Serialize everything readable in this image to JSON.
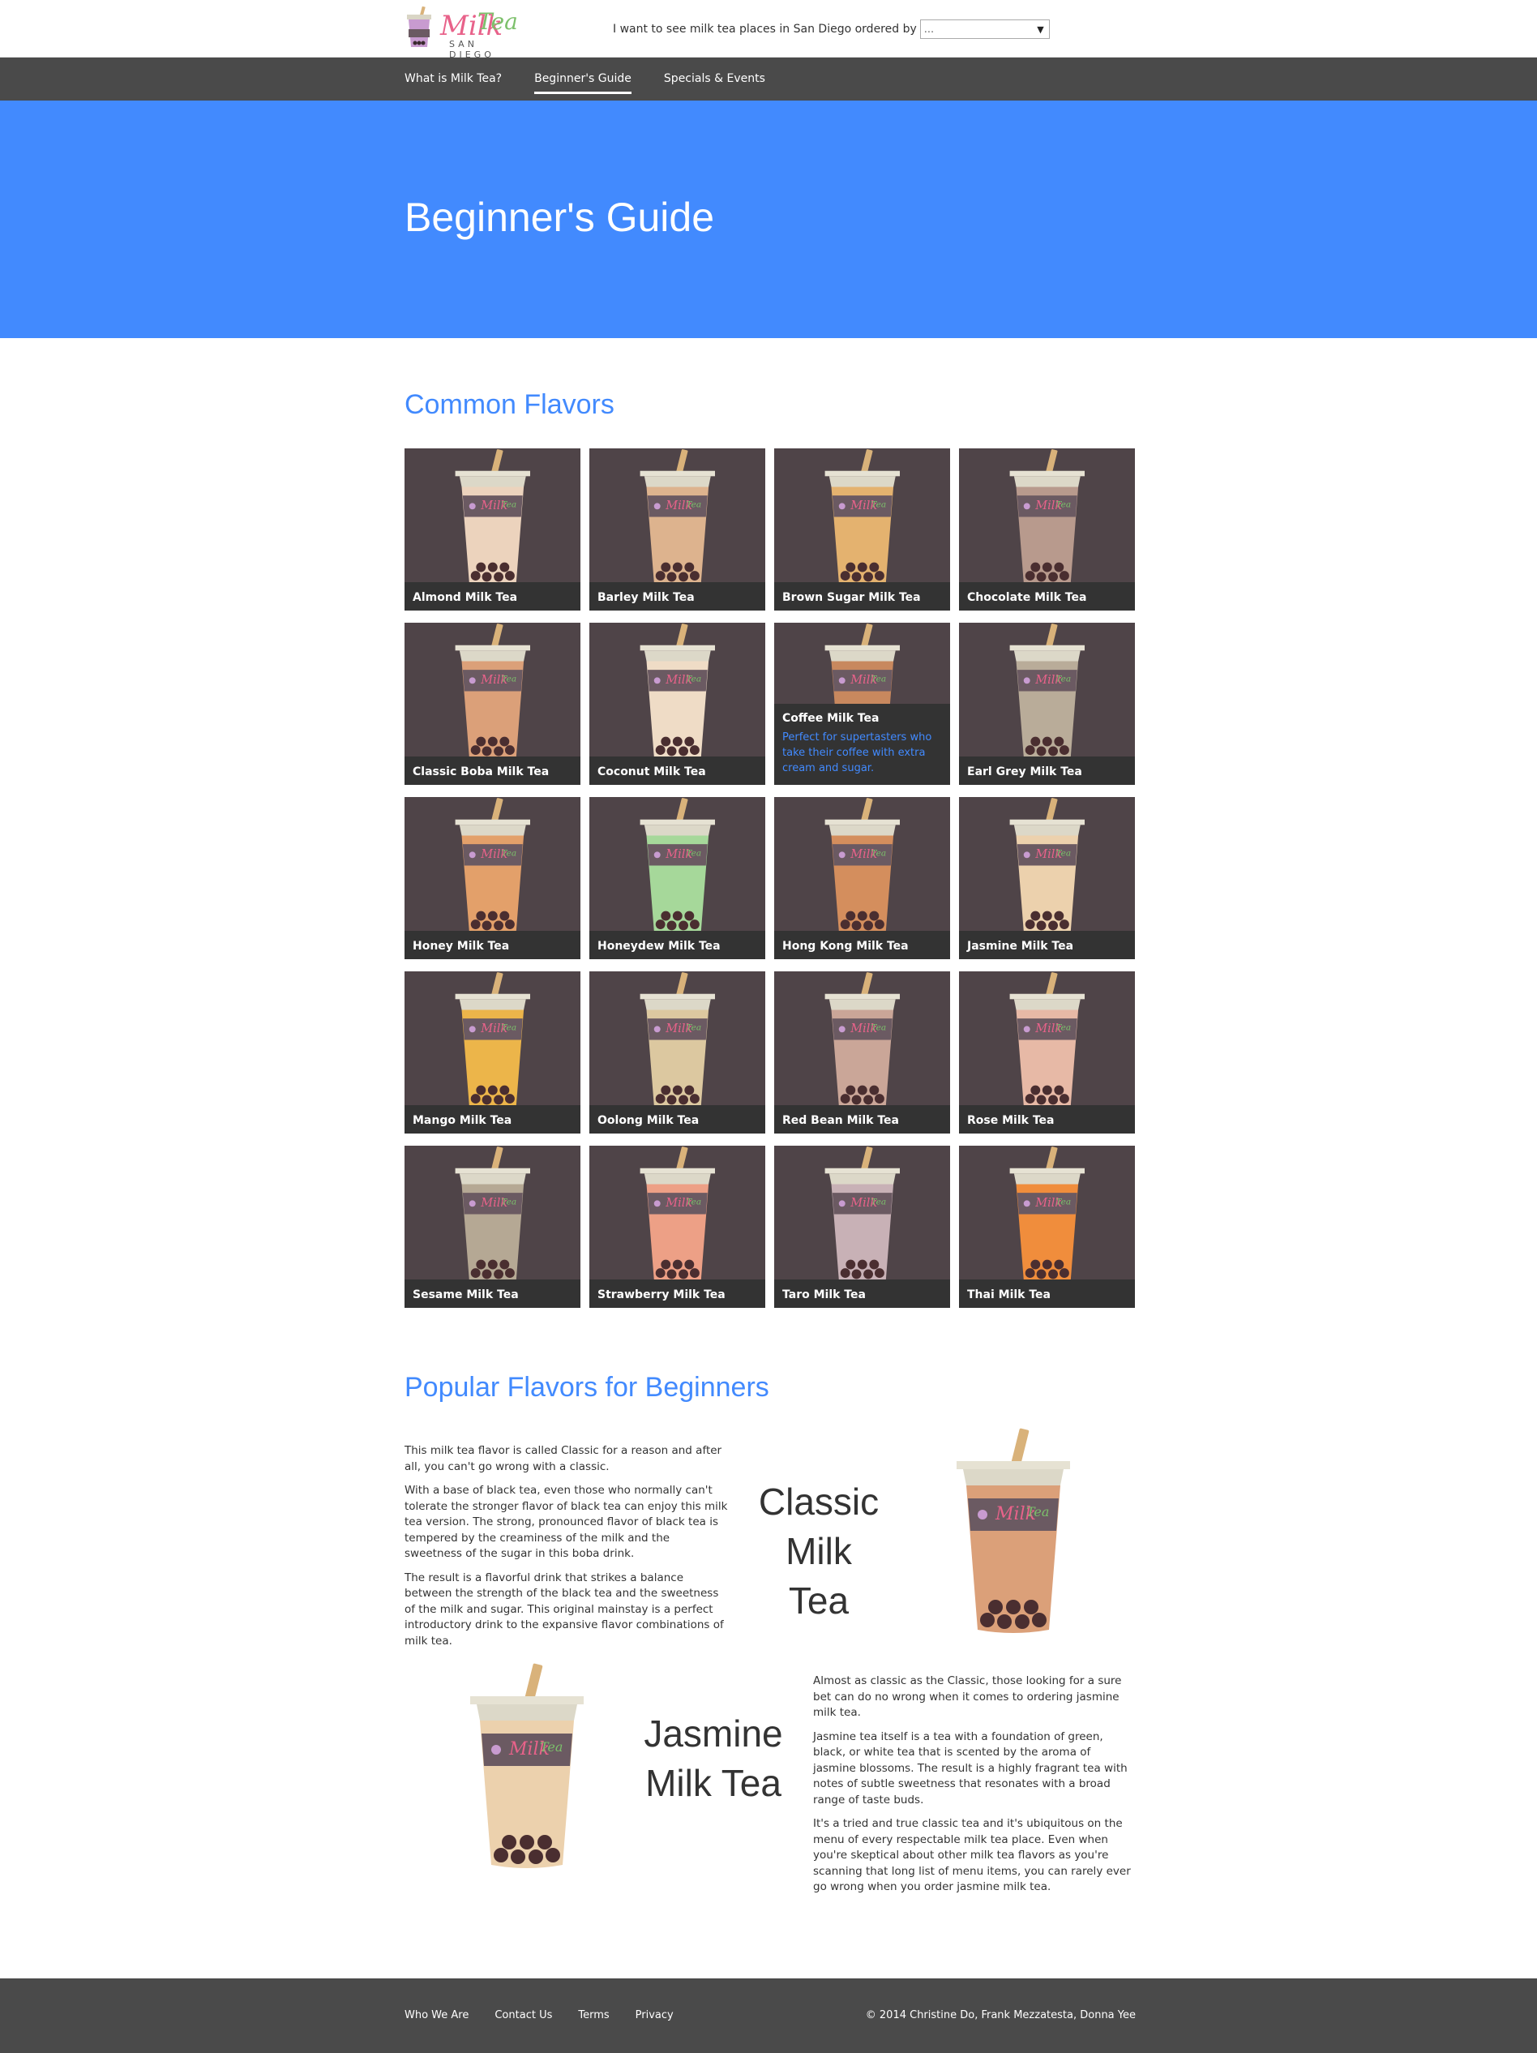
{
  "header": {
    "logo_milk": "Milk",
    "logo_tea": "Tea",
    "logo_sub": "SAN DIEGO",
    "order_label": "I want to see milk tea places in San Diego ordered by",
    "order_value": "..."
  },
  "nav": {
    "items": [
      {
        "label": "What is Milk Tea?"
      },
      {
        "label": "Beginner's Guide"
      },
      {
        "label": "Specials & Events"
      }
    ]
  },
  "hero": {
    "title": "Beginner's Guide"
  },
  "common": {
    "title": "Common Flavors",
    "hover_desc": "Perfect for supertasters who take their coffee with extra cream and sugar.",
    "flavors": [
      {
        "name": "Almond Milk Tea",
        "color": "#ecd3bd"
      },
      {
        "name": "Barley Milk Tea",
        "color": "#ddb38e"
      },
      {
        "name": "Brown Sugar Milk Tea",
        "color": "#e4b26f"
      },
      {
        "name": "Chocolate Milk Tea",
        "color": "#b89a8d"
      },
      {
        "name": "Classic Boba Milk Tea",
        "color": "#dba079"
      },
      {
        "name": "Coconut Milk Tea",
        "color": "#efdcc6"
      },
      {
        "name": "Coffee Milk Tea",
        "color": "#c8885e"
      },
      {
        "name": "Earl Grey Milk Tea",
        "color": "#b9ac99"
      },
      {
        "name": "Honey Milk Tea",
        "color": "#e3a06a"
      },
      {
        "name": "Honeydew Milk Tea",
        "color": "#a6d89a"
      },
      {
        "name": "Hong Kong Milk Tea",
        "color": "#d48e5d"
      },
      {
        "name": "Jasmine Milk Tea",
        "color": "#ecd1ad"
      },
      {
        "name": "Mango Milk Tea",
        "color": "#ecb54a"
      },
      {
        "name": "Oolong Milk Tea",
        "color": "#dcc8a0"
      },
      {
        "name": "Red Bean Milk Tea",
        "color": "#caa698"
      },
      {
        "name": "Rose Milk Tea",
        "color": "#e7b9a6"
      },
      {
        "name": "Sesame Milk Tea",
        "color": "#b5a894"
      },
      {
        "name": "Strawberry Milk Tea",
        "color": "#eda086"
      },
      {
        "name": "Taro Milk Tea",
        "color": "#c8b1b6"
      },
      {
        "name": "Thai Milk Tea",
        "color": "#f08d3c"
      }
    ]
  },
  "popular": {
    "title": "Popular Flavors for Beginners",
    "classic": {
      "big": "Classic Milk Tea",
      "color": "#dba079",
      "paragraphs": [
        "This milk tea flavor is called Classic for a reason and after all, you can't go wrong with a classic.",
        "With a base of black tea, even those who normally can't tolerate the stronger flavor of black tea can enjoy this milk tea version. The strong, pronounced flavor of black tea is tempered by the creaminess of the milk and the sweetness of the sugar in this boba drink.",
        "The result is a flavorful drink that strikes a balance between the strength of the black tea and the sweetness of the milk and sugar. This original mainstay is a perfect introductory drink to the expansive flavor combinations of milk tea."
      ]
    },
    "jasmine": {
      "big": "Jasmine Milk Tea",
      "color": "#ecd1ad",
      "paragraphs": [
        "Almost as classic as the Classic, those looking for a sure bet can do no wrong when it comes to ordering jasmine milk tea.",
        "Jasmine tea itself is a tea with a foundation of green, black, or white tea that is scented by the aroma of jasmine blossoms. The result is a highly fragrant tea with notes of subtle sweetness that resonates with a broad range of taste buds.",
        "It's a tried and true classic tea and it's ubiquitous on the menu of every respectable milk tea place. Even when you're skeptical about other milk tea flavors as you're scanning that long list of menu items, you can rarely ever go wrong when you order jasmine milk tea."
      ]
    }
  },
  "footer": {
    "links": [
      {
        "label": "Who We Are"
      },
      {
        "label": "Contact Us"
      },
      {
        "label": "Terms"
      },
      {
        "label": "Privacy"
      }
    ],
    "copyright": "© 2014 Christine Do, Frank Mezzatesta, Donna Yee"
  }
}
